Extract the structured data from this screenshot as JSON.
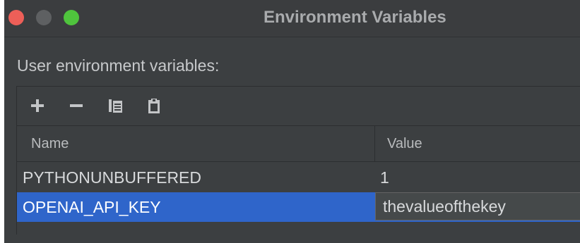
{
  "window": {
    "title": "Environment Variables"
  },
  "section": {
    "label": "User environment variables:"
  },
  "toolbar": {
    "buttons": [
      {
        "name": "add",
        "icon": "plus-icon"
      },
      {
        "name": "remove",
        "icon": "minus-icon"
      },
      {
        "name": "copy",
        "icon": "copy-icon"
      },
      {
        "name": "paste",
        "icon": "clipboard-icon"
      }
    ]
  },
  "table": {
    "columns": [
      "Name",
      "Value"
    ],
    "rows": [
      {
        "name": "PYTHONUNBUFFERED",
        "value": "1",
        "selected": false
      },
      {
        "name": "OPENAI_API_KEY",
        "value": "thevalueofthekey",
        "selected": true,
        "editing": true
      }
    ]
  },
  "colors": {
    "window_bg": "#3c3f41",
    "selection": "#2f65ca",
    "traffic_close": "#ed5f58",
    "traffic_minimize": "#5e6062",
    "traffic_zoom": "#4fc43d"
  }
}
